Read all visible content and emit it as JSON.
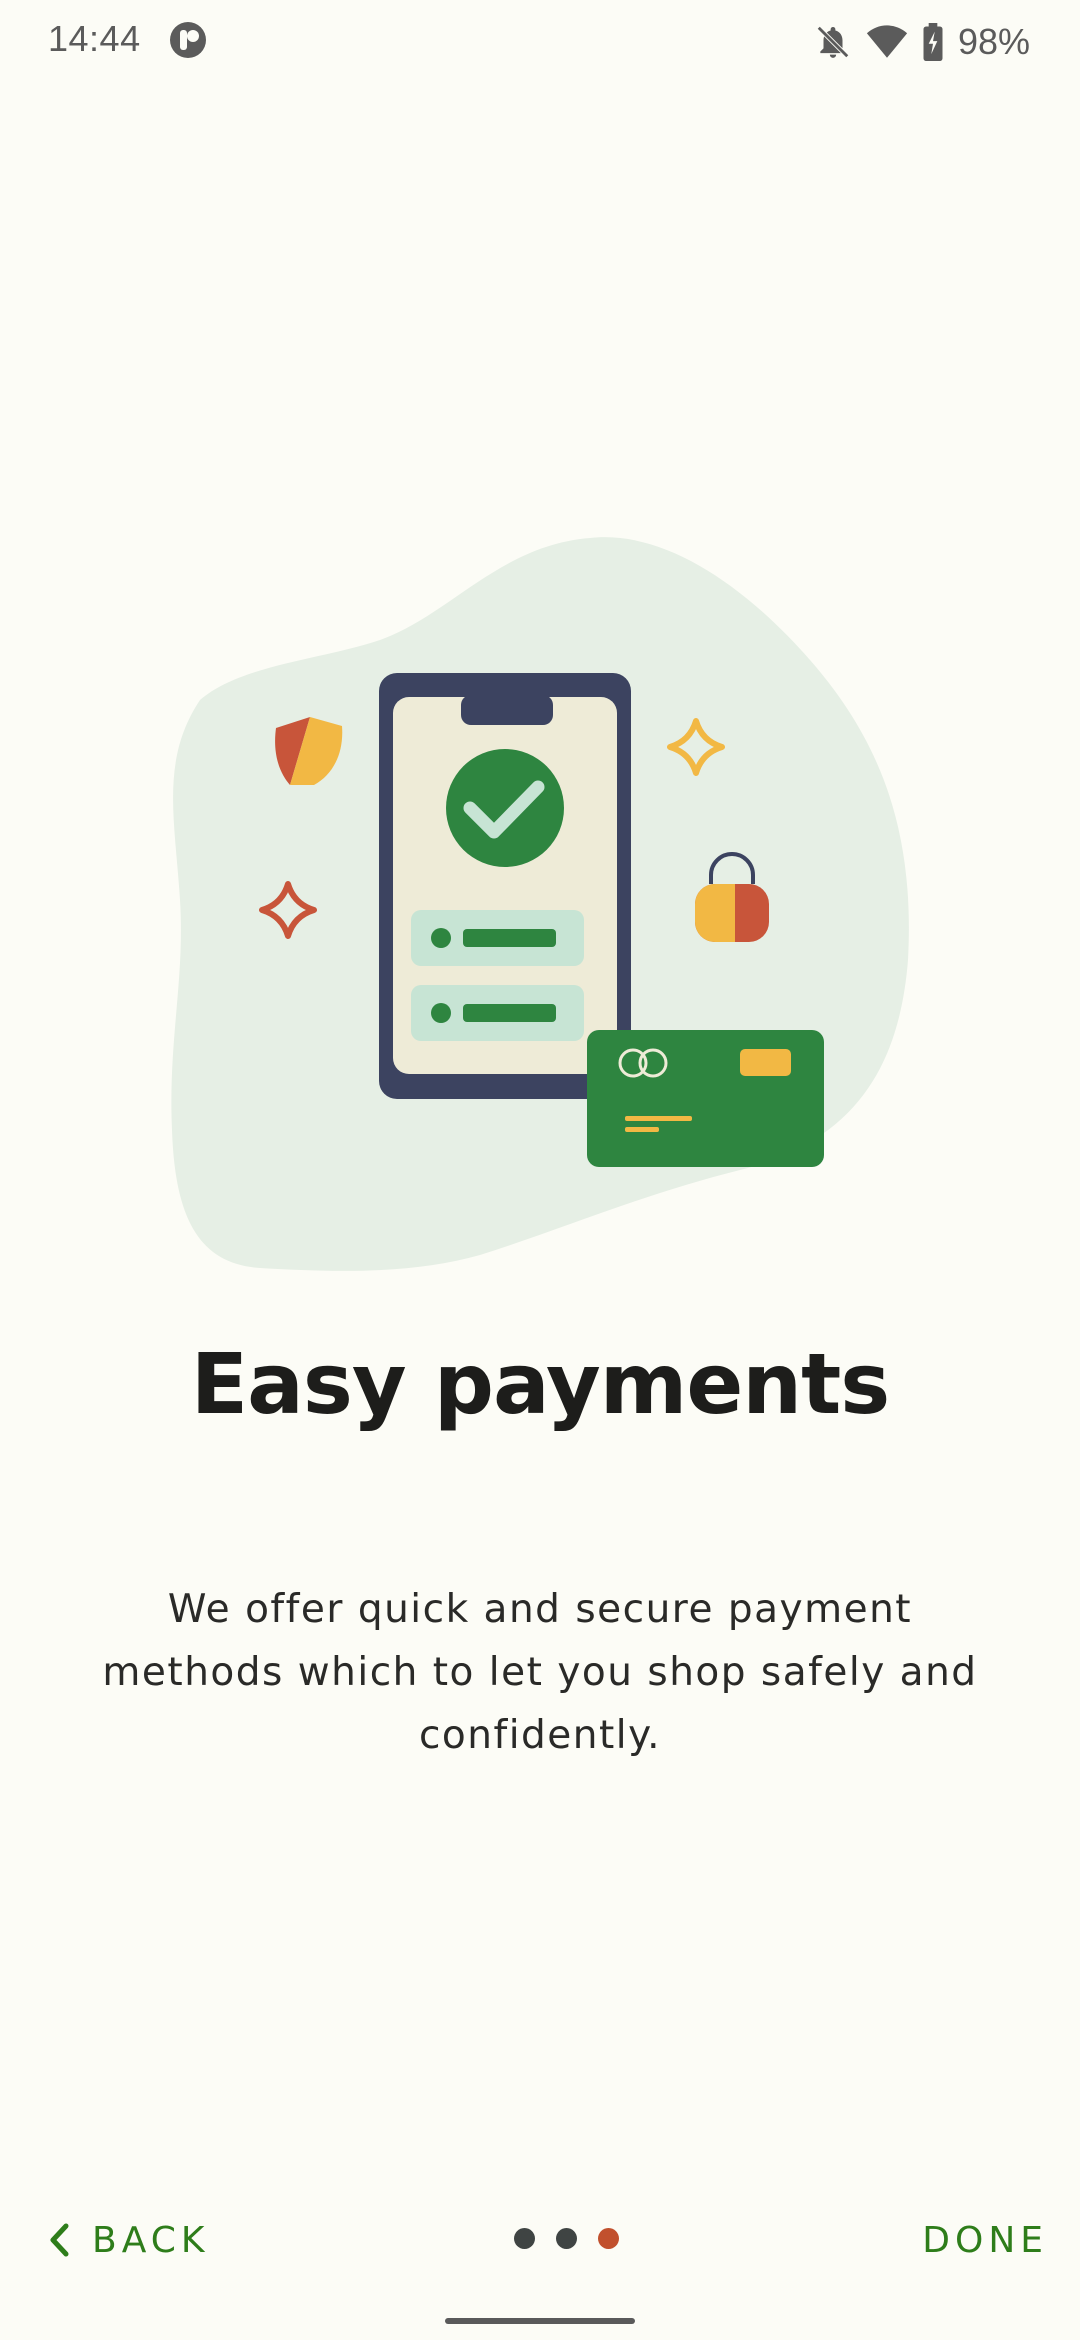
{
  "status_bar": {
    "time": "14:44",
    "battery": "98%",
    "icons": [
      "app-badge-icon",
      "bell-off-icon",
      "wifi-icon",
      "battery-charging-icon"
    ]
  },
  "illustration": {
    "icons": [
      "shield-icon",
      "sparkle-icon",
      "phone-icon",
      "check-circle-icon",
      "lock-icon",
      "credit-card-icon"
    ],
    "colors": {
      "blob": "#e6efe5",
      "phone": "#3c4360",
      "screen": "#eeebd7",
      "green": "#2e8540",
      "orange": "#c8553a",
      "yellow": "#f2b844"
    }
  },
  "content": {
    "title": "Easy payments",
    "description": "We offer quick and secure payment methods which to let you shop safely and confidently."
  },
  "navigation": {
    "back_label": "BACK",
    "done_label": "DONE",
    "page_count": 3,
    "active_page": 3,
    "accent_color": "#2e7d1a",
    "active_dot_color": "#c1502d"
  }
}
